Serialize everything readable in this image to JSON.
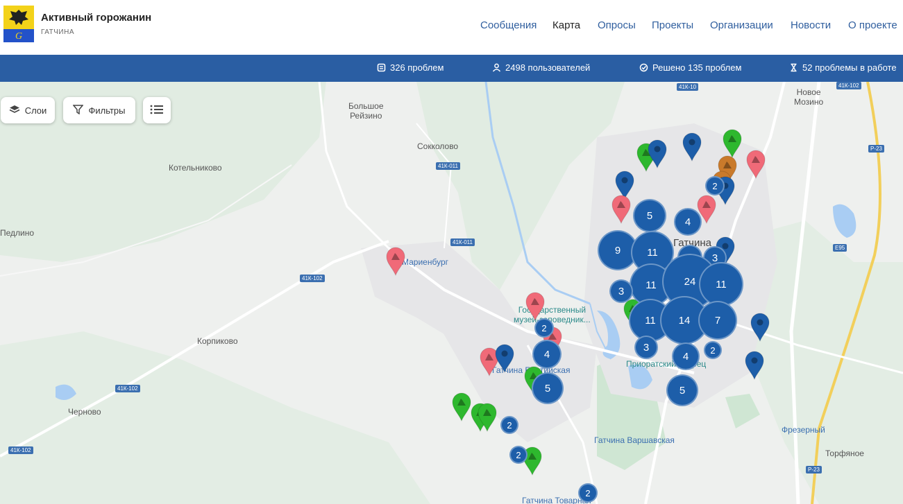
{
  "app": {
    "title": "Активный горожанин",
    "subtitle": "ГАТЧИНА"
  },
  "nav": [
    {
      "label": "Сообщения"
    },
    {
      "label": "Карта"
    },
    {
      "label": "Опросы"
    },
    {
      "label": "Проекты"
    },
    {
      "label": "Организации"
    },
    {
      "label": "Новости"
    },
    {
      "label": "О проекте"
    }
  ],
  "stats": [
    {
      "label": "326 проблем",
      "icon": "problems-icon"
    },
    {
      "label": "2498 пользователей",
      "icon": "user-icon"
    },
    {
      "label": "Решено 135 проблем",
      "icon": "check-icon"
    },
    {
      "label": "52 проблемы в работе",
      "icon": "hourglass-icon"
    }
  ],
  "controls": {
    "layers": "Слои",
    "filters": "Фильтры"
  },
  "places": [
    {
      "label": "Большое\nРейзино"
    },
    {
      "label": "Сокколово"
    },
    {
      "label": "Котельниково"
    },
    {
      "label": "Педлино"
    },
    {
      "label": "Мариенбург"
    },
    {
      "label": "Государственный\nмузей-заповедник..."
    },
    {
      "label": "Корпиково"
    },
    {
      "label": "Гатчина Балтийская"
    },
    {
      "label": "Приоратский дворец"
    },
    {
      "label": "Черново"
    },
    {
      "label": "Гатчина Варшавская"
    },
    {
      "label": "Фрезерный"
    },
    {
      "label": "Торфяное"
    },
    {
      "label": "Новое\nМозино"
    },
    {
      "label": "Гатчина"
    },
    {
      "label": "Гатчина Товарная"
    }
  ],
  "roads": [
    "41К-10",
    "41К-011",
    "41К-011",
    "41К-102",
    "41К-102",
    "41К-102",
    "41К-102",
    "Р-23",
    "Р-23",
    "E95"
  ],
  "clusters": [
    "5",
    "4",
    "9",
    "11",
    "2",
    "3",
    "11",
    "24",
    "11",
    "3",
    "11",
    "14",
    "7",
    "2",
    "4",
    "2",
    "4",
    "3",
    "5",
    "2",
    "5",
    "2",
    "2",
    "2"
  ],
  "colors": {
    "cluster": "#1d5ea9",
    "pin_blue": "#1d5ea9",
    "pin_red": "#f06a78",
    "pin_green": "#2eb82e",
    "pin_orange": "#c97a2b",
    "header_bar": "#2a5ea3"
  }
}
